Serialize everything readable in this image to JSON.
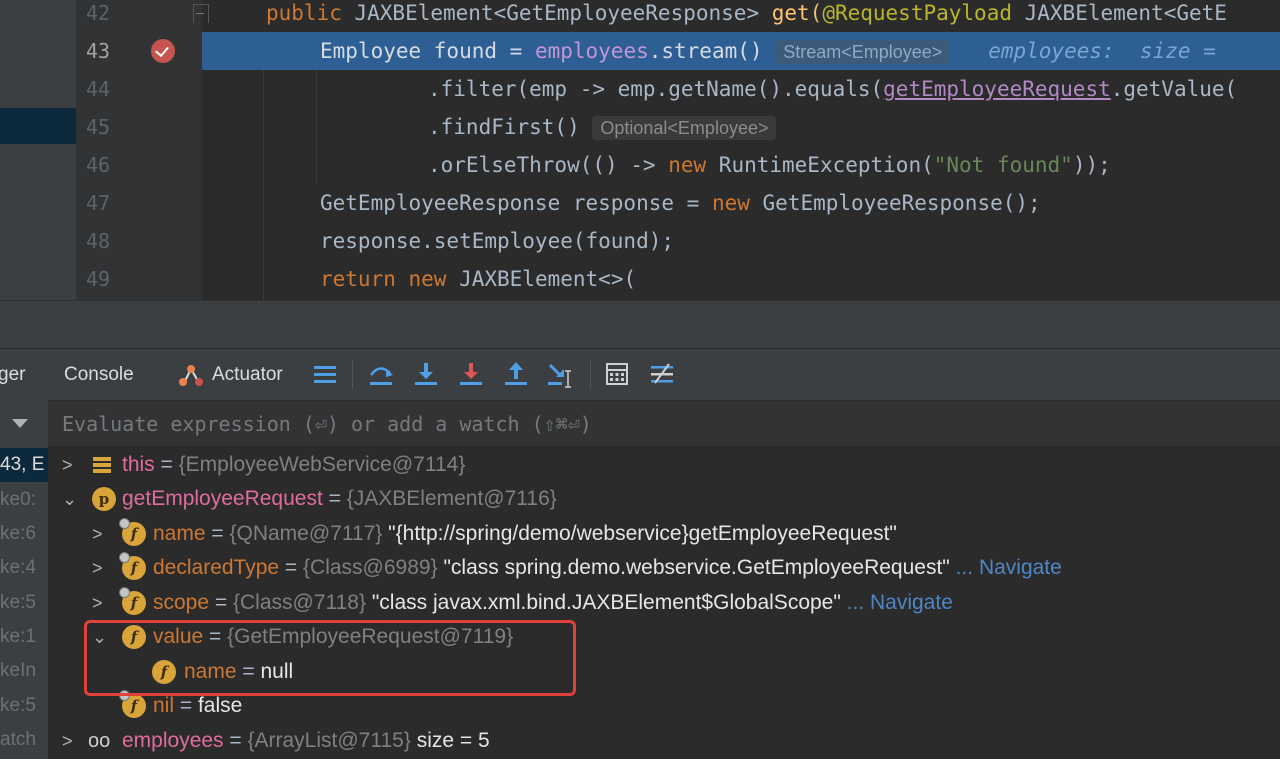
{
  "editor": {
    "line_numbers": [
      "42",
      "43",
      "44",
      "45",
      "46",
      "47",
      "48",
      "49"
    ],
    "line42": {
      "kw": "public",
      "text1": " JAXBElement<GetEmployeeResponse> ",
      "method": "get",
      "paren": "(",
      "ann": "@RequestPayload",
      "text2": " JAXBElement<GetE"
    },
    "line43": {
      "text1": "Employee found = ",
      "field": "employees",
      "text2": ".stream()",
      "hint": "Stream<Employee>",
      "inline": "employees:  size ="
    },
    "line44": {
      "text1": ".filter(emp -> emp.getName().equals(",
      "param": "getEmployeeRequest",
      "text2": ".getValue("
    },
    "line45": {
      "text1": ".findFirst()",
      "hint": "Optional<Employee>"
    },
    "line46": {
      "text1": ".orElseThrow(() -> ",
      "kw": "new",
      "text2": " RuntimeException(",
      "str": "\"Not found\"",
      "text3": "));"
    },
    "line47": {
      "text1": "GetEmployeeResponse response = ",
      "kw": "new",
      "text2": " GetEmployeeResponse();"
    },
    "line48": {
      "text1": "response.setEmployee(found);"
    },
    "line49": {
      "kw1": "return",
      "kw2": "new",
      "text1": " JAXBElement<>("
    }
  },
  "toolbar": {
    "tab_debugger": "ger",
    "tab_console": "Console",
    "tab_actuator": "Actuator",
    "icons": [
      "threads-icon",
      "step-over-icon",
      "step-into-icon",
      "force-step-into-icon",
      "step-out-icon",
      "run-to-cursor-icon",
      "evaluate-icon",
      "trace-icon"
    ]
  },
  "watch": {
    "placeholder": "Evaluate expression (⏎) or add a watch (⇧⌘⏎)"
  },
  "frames": [
    "43, E",
    "ke0:",
    "ke:6",
    "ke:4",
    "ke:5",
    "ke:1",
    "keIn",
    "ke:5",
    "atch"
  ],
  "variables": [
    {
      "name": "this",
      "eq": " = ",
      "type": "{EmployeeWebService@7114}"
    },
    {
      "name": "getEmployeeRequest",
      "eq": " = ",
      "type": "{JAXBElement@7116}"
    },
    {
      "name": "name",
      "eq": " = ",
      "type": "{QName@7117} ",
      "value": "\"{http://spring/demo/webservice}getEmployeeRequest\""
    },
    {
      "name": "declaredType",
      "eq": " = ",
      "type": "{Class@6989} ",
      "value": "\"class spring.demo.webservice.GetEmployeeRequest\"",
      "nav": " ... Navigate"
    },
    {
      "name": "scope",
      "eq": " = ",
      "type": "{Class@7118} ",
      "value": "\"class javax.xml.bind.JAXBElement$GlobalScope\"",
      "nav": " ... Navigate"
    },
    {
      "name": "value",
      "eq": " = ",
      "type": "{GetEmployeeRequest@7119}"
    },
    {
      "name": "name",
      "eq": " = ",
      "value": "null"
    },
    {
      "name": "nil",
      "eq": " = ",
      "value": "false"
    },
    {
      "name": "employees",
      "eq": " = ",
      "type": "{ArrayList@7115}",
      "extra": "  size = 5"
    }
  ],
  "highlight_color": "#e0413a"
}
